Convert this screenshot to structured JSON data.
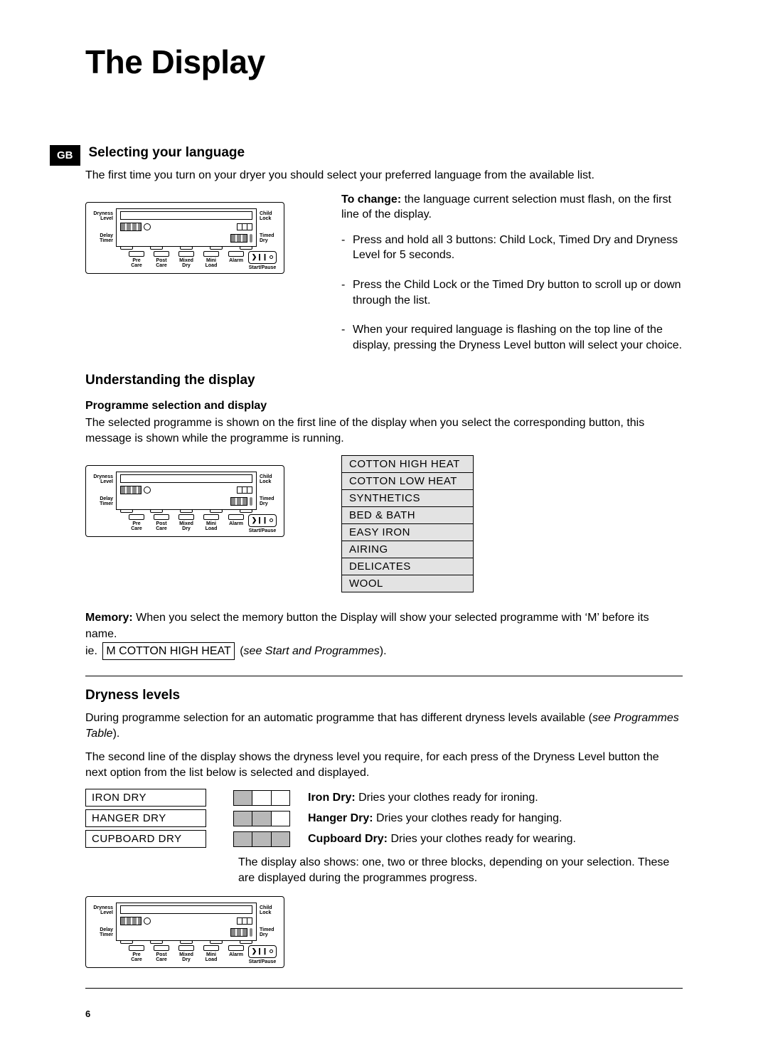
{
  "title": "The Display",
  "language_code": "GB",
  "page_number": "6",
  "section_language": {
    "heading": "Selecting your language",
    "intro": "The first time you turn on your dryer you should select your preferred language from the available list.",
    "change_bold": "To change:",
    "change_text": " the language current selection must flash, on the first line of the display.",
    "steps": [
      "Press and hold all 3 buttons: Child Lock, Timed Dry and Dryness Level for 5 seconds.",
      "Press the Child Lock or the Timed Dry button to scroll up or down through the list.",
      "When your required language is flashing on the top line of the display, pressing the Dryness Level button will select your choice."
    ]
  },
  "section_understanding": {
    "heading": "Understanding the display",
    "sub_heading": "Programme selection and display",
    "para": "The selected programme is shown on the first line of the display when you select the corresponding button, this message is shown while the programme is running.",
    "programmes": [
      "COTTON HIGH HEAT",
      "COTTON LOW HEAT",
      "SYNTHETICS",
      "BED & BATH",
      "EASY IRON",
      "AIRING",
      "DELICATES",
      "WOOL"
    ],
    "memory_bold": "Memory:",
    "memory_text": " When you select the memory button the Display will show your selected programme with ‘M’ before its name.",
    "memory_ie": "ie.",
    "memory_box": " M  COTTON HIGH HEAT ",
    "memory_see_prefix": "(",
    "memory_see_italic": "see Start and Programmes",
    "memory_see_suffix": ")."
  },
  "section_dryness": {
    "heading": "Dryness levels",
    "para1_a": "During programme selection for an automatic programme that has different dryness levels available (",
    "para1_italic": "see Programmes Table",
    "para1_b": ").",
    "para2": "The second line of the display shows the dryness level you require, for each press of the Dryness Level button the next option from the list below is selected and displayed.",
    "levels": [
      {
        "label": "IRON DRY",
        "blocks": 1,
        "desc_bold": "Iron Dry:",
        "desc": " Dries your clothes ready for ironing."
      },
      {
        "label": "HANGER DRY",
        "blocks": 2,
        "desc_bold": "Hanger Dry:",
        "desc": " Dries your clothes ready for hanging."
      },
      {
        "label": "CUPBOARD DRY",
        "blocks": 3,
        "desc_bold": "Cupboard Dry:",
        "desc": " Dries your clothes ready for wearing."
      }
    ],
    "note": "The display also shows: one, two or three blocks, depending on your selection. These are displayed during the programmes progress."
  },
  "panel": {
    "dryness": "Dryness\nLevel",
    "delay": "Delay\nTimer",
    "child": "Child\nLock",
    "timed": "Timed\nDry",
    "options": [
      "Pre\nCare",
      "Post\nCare",
      "Mixed\nDry",
      "Mini\nLoad",
      "Alarm"
    ],
    "start_label": "Start/Pause",
    "start_glyph": "❯❙❙"
  }
}
